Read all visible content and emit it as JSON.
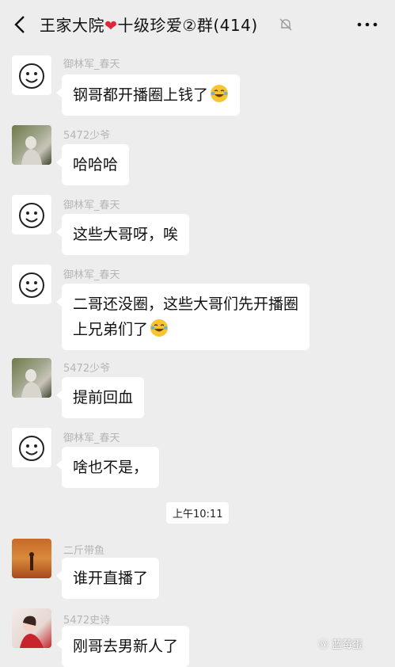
{
  "header": {
    "title_left": "王家大院",
    "heart_icon": "heart-emoji",
    "title_right": "十级珍爱②群(414)",
    "back_icon": "chevron-left-icon",
    "mute_icon": "bell-off-icon",
    "more_icon": "more-dots-icon"
  },
  "messages": [
    {
      "nick": "御林军_春天",
      "lines": [
        "钢哥都开播圈上钱了"
      ],
      "emoji": "crying-laughing"
    },
    {
      "nick": "5472少爷",
      "lines": [
        "哈哈哈"
      ]
    },
    {
      "nick": "御林军_春天",
      "lines": [
        "这些大哥呀，唉"
      ]
    },
    {
      "nick": "御林军_春天",
      "lines": [
        "二哥还没圈，这些大哥们先开播圈",
        "上兄弟们了"
      ],
      "emoji": "crying-laughing"
    },
    {
      "nick": "5472少爷",
      "lines": [
        "提前回血"
      ]
    },
    {
      "nick": "御林军_春天",
      "lines": [
        "啥也不是，"
      ]
    },
    {
      "nick": "二斤带鱼",
      "lines": [
        "谁开直播了"
      ]
    },
    {
      "nick": "5472史诗",
      "lines": [
        "刚哥去男新人了"
      ]
    }
  ],
  "timestamp": "上午10:11",
  "watermark": "蓝莓蛋",
  "colors": {
    "background": "#ededed",
    "bubble": "#ffffff",
    "heart": "#e0263a"
  }
}
